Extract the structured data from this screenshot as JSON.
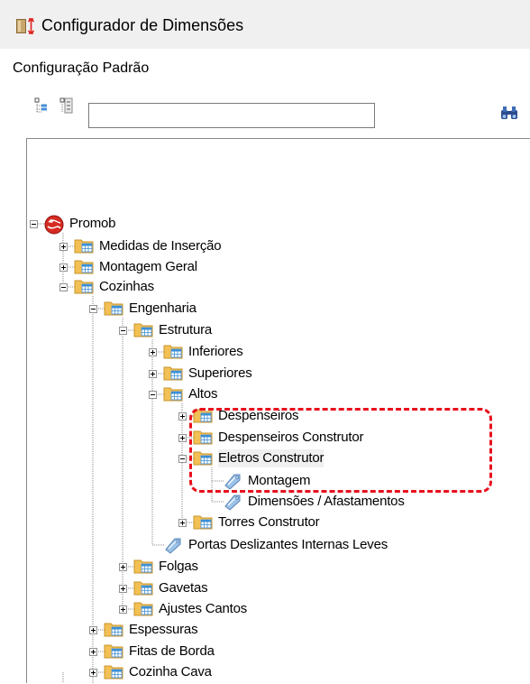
{
  "window": {
    "title": "Configurador de Dimensões"
  },
  "subtitle": "Configuração Padrão",
  "toolbar": {
    "search_value": "",
    "search_placeholder": ""
  },
  "tree": {
    "nodes": [
      {
        "label": "Promob",
        "icon": "globe-icon",
        "expander": "minus"
      },
      {
        "label": "Medidas de Inserção",
        "icon": "folder-icon",
        "expander": "plus"
      },
      {
        "label": "Montagem Geral",
        "icon": "folder-icon",
        "expander": "plus"
      },
      {
        "label": "Cozinhas",
        "icon": "folder-icon",
        "expander": "minus"
      },
      {
        "label": "Engenharia",
        "icon": "folder-icon",
        "expander": "minus"
      },
      {
        "label": "Estrutura",
        "icon": "folder-icon",
        "expander": "minus"
      },
      {
        "label": "Inferiores",
        "icon": "folder-icon",
        "expander": "plus"
      },
      {
        "label": "Superiores",
        "icon": "folder-icon",
        "expander": "plus"
      },
      {
        "label": "Altos",
        "icon": "folder-icon",
        "expander": "minus"
      },
      {
        "label": "Despenseiros",
        "icon": "folder-icon",
        "expander": "plus"
      },
      {
        "label": "Despenseiros Construtor",
        "icon": "folder-icon",
        "expander": "plus"
      },
      {
        "label": "Eletros Construtor",
        "icon": "folder-icon",
        "expander": "minus",
        "selected": true
      },
      {
        "label": "Montagem",
        "icon": "tag-icon",
        "expander": "none"
      },
      {
        "label": "Dimensões / Afastamentos",
        "icon": "tag-icon",
        "expander": "none"
      },
      {
        "label": "Torres Construtor",
        "icon": "folder-icon",
        "expander": "plus"
      },
      {
        "label": "Portas Deslizantes Internas Leves",
        "icon": "tag-icon",
        "expander": "none"
      },
      {
        "label": "Folgas",
        "icon": "folder-icon",
        "expander": "plus"
      },
      {
        "label": "Gavetas",
        "icon": "folder-icon",
        "expander": "plus"
      },
      {
        "label": "Ajustes Cantos",
        "icon": "folder-icon",
        "expander": "plus"
      },
      {
        "label": "Espessuras",
        "icon": "folder-icon",
        "expander": "plus"
      },
      {
        "label": "Fitas de Borda",
        "icon": "folder-icon",
        "expander": "plus"
      },
      {
        "label": "Cozinha Cava",
        "icon": "folder-icon",
        "expander": "plus"
      }
    ]
  },
  "colors": {
    "highlight": "#e8101c",
    "folder_fill": "#f2c054",
    "folder_edge": "#c8962a",
    "table_fill": "#3b8fd6",
    "tag_fill": "#9cc3e8",
    "globe_fill": "#d62b22",
    "titlebar_bg": "#f0f0f0"
  }
}
